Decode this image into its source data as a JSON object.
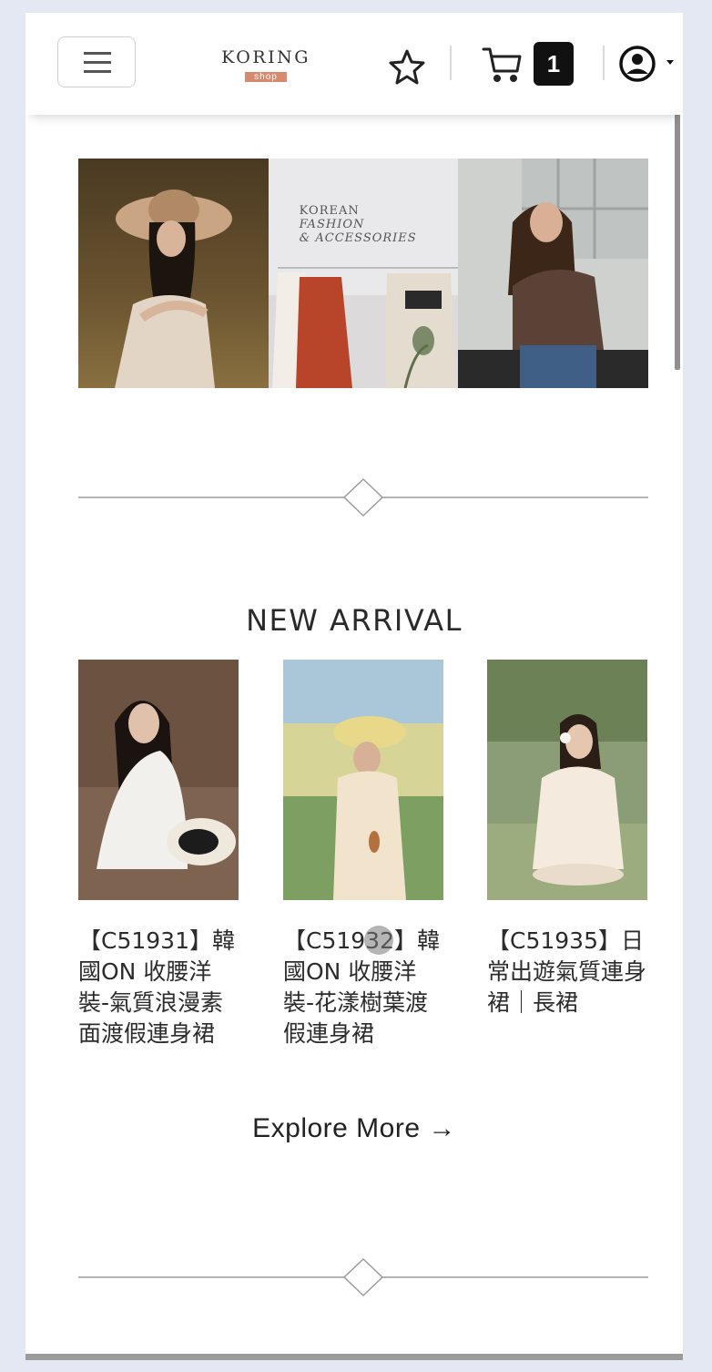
{
  "header": {
    "brand": "KORING",
    "brand_sub": "shop",
    "cart_count": "1",
    "icons": [
      "menu-icon",
      "star-icon",
      "cart-icon",
      "user-icon",
      "caret-down-icon"
    ]
  },
  "hero": {
    "panel_text_line1": "KOREAN",
    "panel_text_line2": "FASHION",
    "panel_text_line3": "& ACCESSORIES"
  },
  "new_arrival": {
    "title": "NEW ARRIVAL",
    "products": [
      {
        "title": "【C51931】韓國ON 收腰洋裝-氣質浪漫素面渡假連身裙"
      },
      {
        "title": "【C51932】韓國ON 收腰洋裝-花漾樹葉渡假連身裙"
      },
      {
        "title": "【C51935】日常出遊氣質連身裙｜長裙"
      }
    ],
    "explore_label": "Explore More →"
  },
  "colors": {
    "page_bg": "#e3e8f2",
    "brand_accent": "#d78a6d",
    "badge_bg": "#111111"
  }
}
